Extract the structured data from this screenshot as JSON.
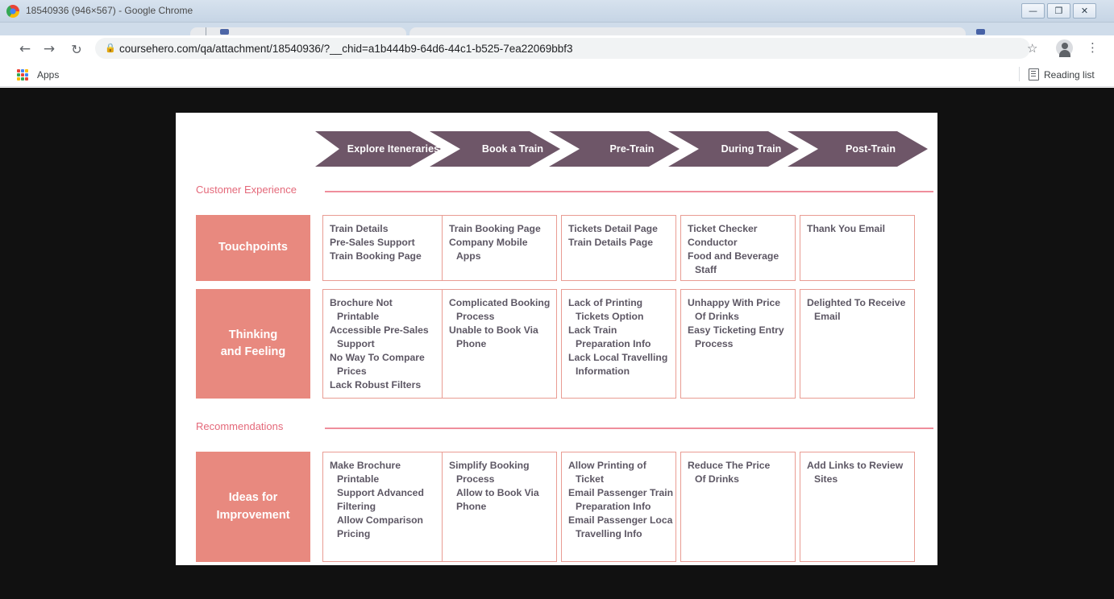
{
  "browser": {
    "window_title": "18540936 (946×567) - Google Chrome",
    "url": "coursehero.com/qa/attachment/18540936/?__chid=a1b444b9-64d6-44c1-b525-7ea22069bbf3",
    "apps_label": "Apps",
    "reading_list_label": "Reading list",
    "minimize_glyph": "—",
    "maximize_glyph": "❐",
    "close_glyph": "✕",
    "back_glyph": "←",
    "forward_glyph": "→",
    "reload_glyph": "↻",
    "lock_glyph": "🔒",
    "star_glyph": "☆",
    "menu_glyph": "⋮"
  },
  "map": {
    "stages": [
      {
        "label": "Explore Iteneraries"
      },
      {
        "label": "Book a Train"
      },
      {
        "label": "Pre-Train"
      },
      {
        "label": "During Train"
      },
      {
        "label": "Post-Train"
      }
    ],
    "sections": [
      {
        "id": "customer-experience",
        "label": "Customer Experience"
      },
      {
        "id": "recommendations",
        "label": "Recommendations"
      }
    ],
    "rows": [
      {
        "id": "touchpoints",
        "label": "Touchpoints",
        "cells": [
          {
            "lines": [
              {
                "text": "Train Details",
                "indent": false
              },
              {
                "text": "Pre-Sales Support",
                "indent": false
              },
              {
                "text": "Train Booking Page",
                "indent": false
              }
            ]
          },
          {
            "lines": [
              {
                "text": "Train Booking Page",
                "indent": false
              },
              {
                "text": "Company Mobile",
                "indent": false
              },
              {
                "text": "Apps",
                "indent": true
              }
            ]
          },
          {
            "lines": [
              {
                "text": "Tickets Detail Page",
                "indent": false
              },
              {
                "text": "Train Details Page",
                "indent": false
              }
            ]
          },
          {
            "lines": [
              {
                "text": "Ticket Checker",
                "indent": false
              },
              {
                "text": "Conductor",
                "indent": false
              },
              {
                "text": "Food and Beverage",
                "indent": false
              },
              {
                "text": "Staff",
                "indent": true
              }
            ]
          },
          {
            "lines": [
              {
                "text": "Thank You Email",
                "indent": false
              }
            ]
          }
        ]
      },
      {
        "id": "thinking-and-feeling",
        "label": "Thinking\nand Feeling",
        "cells": [
          {
            "lines": [
              {
                "text": "Brochure Not",
                "indent": false
              },
              {
                "text": "Printable",
                "indent": true
              },
              {
                "text": "Accessible Pre-Sales",
                "indent": false
              },
              {
                "text": "Support",
                "indent": true
              },
              {
                "text": "No Way To Compare",
                "indent": false
              },
              {
                "text": "Prices",
                "indent": true
              },
              {
                "text": "Lack Robust Filters",
                "indent": false
              }
            ]
          },
          {
            "lines": [
              {
                "text": "Complicated Booking",
                "indent": false
              },
              {
                "text": "Process",
                "indent": true
              },
              {
                "text": "Unable to Book Via",
                "indent": false
              },
              {
                "text": "Phone",
                "indent": true
              }
            ]
          },
          {
            "lines": [
              {
                "text": "Lack of Printing",
                "indent": false
              },
              {
                "text": "Tickets Option",
                "indent": true
              },
              {
                "text": "Lack Train",
                "indent": false
              },
              {
                "text": "Preparation Info",
                "indent": true
              },
              {
                "text": "Lack Local Travelling",
                "indent": false
              },
              {
                "text": "Information",
                "indent": true
              }
            ]
          },
          {
            "lines": [
              {
                "text": "Unhappy With Price",
                "indent": false
              },
              {
                "text": "Of Drinks",
                "indent": true
              },
              {
                "text": "Easy Ticketing Entry",
                "indent": false
              },
              {
                "text": "Process",
                "indent": true
              }
            ]
          },
          {
            "lines": [
              {
                "text": "Delighted To Receive",
                "indent": false
              },
              {
                "text": "Email",
                "indent": true
              }
            ]
          }
        ]
      },
      {
        "id": "ideas-for-improvement",
        "label": "Ideas for\nImprovement",
        "cells": [
          {
            "lines": [
              {
                "text": "Make Brochure",
                "indent": false
              },
              {
                "text": "Printable",
                "indent": true
              },
              {
                "text": "Support Advanced",
                "indent": true
              },
              {
                "text": "Filtering",
                "indent": true
              },
              {
                "text": "Allow Comparison",
                "indent": true
              },
              {
                "text": "Pricing",
                "indent": true
              }
            ]
          },
          {
            "lines": [
              {
                "text": "Simplify Booking",
                "indent": false
              },
              {
                "text": "Process",
                "indent": true
              },
              {
                "text": "Allow to Book Via",
                "indent": true
              },
              {
                "text": "Phone",
                "indent": true
              }
            ]
          },
          {
            "lines": [
              {
                "text": "Allow Printing of",
                "indent": false
              },
              {
                "text": "Ticket",
                "indent": true
              },
              {
                "text": "Email Passenger Train",
                "indent": false
              },
              {
                "text": "Preparation Info",
                "indent": true
              },
              {
                "text": "Email Passenger Loca",
                "indent": false
              },
              {
                "text": "Travelling Info",
                "indent": true
              }
            ]
          },
          {
            "lines": [
              {
                "text": "Reduce The Price",
                "indent": false
              },
              {
                "text": "Of Drinks",
                "indent": true
              }
            ]
          },
          {
            "lines": [
              {
                "text": "Add Links to Review",
                "indent": false
              },
              {
                "text": "Sites",
                "indent": true
              }
            ]
          }
        ]
      }
    ],
    "colors": {
      "stage_purple": "#6e5668",
      "row_label_salmon": "#e8897f",
      "cell_border": "#e99c93",
      "section_label": "#e4697a",
      "section_rule": "#ef8e9c",
      "cell_text": "#5d5764",
      "page_background": "#111111",
      "document_background": "#ffffff"
    }
  }
}
